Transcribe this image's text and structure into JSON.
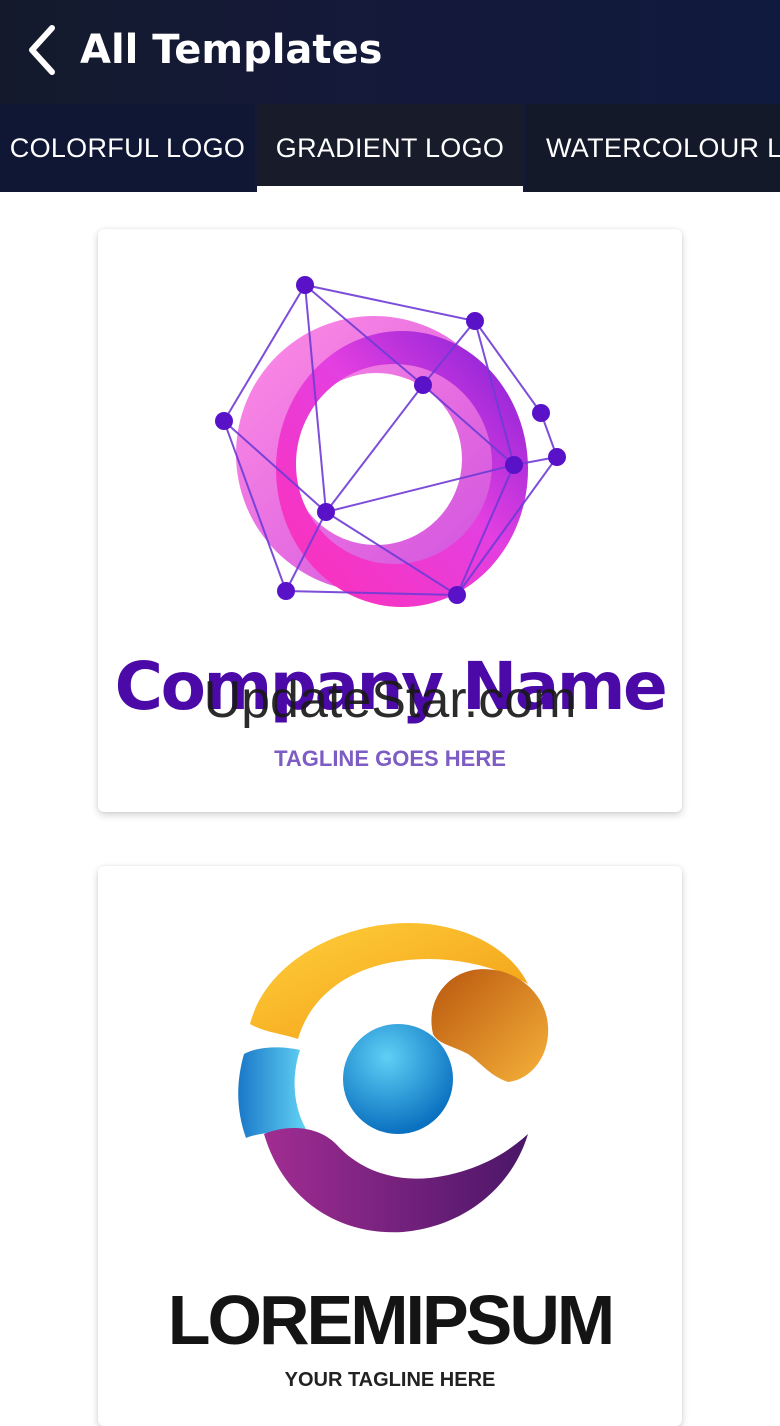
{
  "header": {
    "back_icon": "chevron-left-icon",
    "title": "All Templates"
  },
  "tabs": [
    {
      "label": "COLORFUL LOGO",
      "selected": false
    },
    {
      "label": "GRADIENT LOGO",
      "selected": true
    },
    {
      "label": "WATERCOLOUR LOGO",
      "selected": false
    }
  ],
  "templates": [
    {
      "company_name": "Company Name",
      "tagline": "TAGLINE GOES HERE",
      "colors": {
        "text": "#4b0aa8",
        "ring_start": "#ff3cc8",
        "ring_end": "#7a1fd6"
      }
    },
    {
      "company_name": "LOREMIPSUM",
      "tagline": "YOUR TAGLINE HERE",
      "colors": {
        "text": "#141414",
        "orange": "#f6a019",
        "blue": "#1fa3df",
        "purple": "#8a2a9a"
      }
    }
  ],
  "watermark": "UpdateStar.com"
}
